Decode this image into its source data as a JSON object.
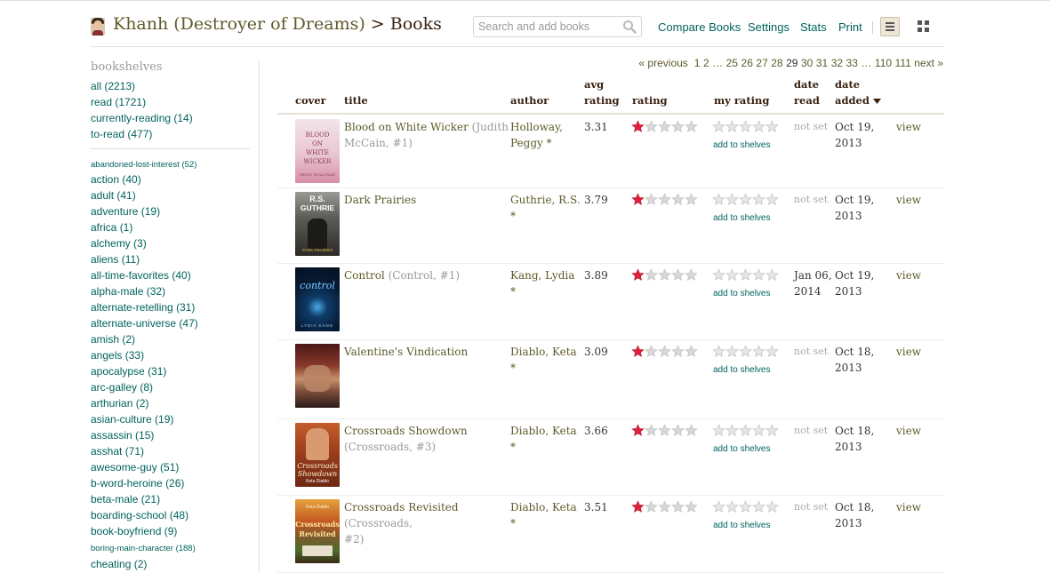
{
  "header": {
    "user_name": "Khanh (Destroyer of Dreams)",
    "breadcrumb_sep": ">",
    "section": "Books",
    "search_placeholder": "Search and add books",
    "links": [
      "Compare Books",
      "Settings",
      "Stats",
      "Print"
    ],
    "link_sep": "|"
  },
  "sidebar": {
    "heading": "bookshelves",
    "main_shelves": [
      {
        "name": "all",
        "count": "(2213)"
      },
      {
        "name": "read",
        "count": "(1721)"
      },
      {
        "name": "currently-reading",
        "count": "(14)"
      },
      {
        "name": "to-read",
        "count": "(477)"
      }
    ],
    "shelves": [
      {
        "name": "abandoned-lost-interest",
        "count": "(52)",
        "small": true
      },
      {
        "name": "action",
        "count": "(40)"
      },
      {
        "name": "adult",
        "count": "(41)"
      },
      {
        "name": "adventure",
        "count": "(19)"
      },
      {
        "name": "africa",
        "count": "(1)"
      },
      {
        "name": "alchemy",
        "count": "(3)"
      },
      {
        "name": "aliens",
        "count": "(11)"
      },
      {
        "name": "all-time-favorites",
        "count": "(40)"
      },
      {
        "name": "alpha-male",
        "count": "(32)"
      },
      {
        "name": "alternate-retelling",
        "count": "(31)"
      },
      {
        "name": "alternate-universe",
        "count": "(47)"
      },
      {
        "name": "amish",
        "count": "(2)"
      },
      {
        "name": "angels",
        "count": "(33)"
      },
      {
        "name": "apocalypse",
        "count": "(31)"
      },
      {
        "name": "arc-galley",
        "count": "(8)"
      },
      {
        "name": "arthurian",
        "count": "(2)"
      },
      {
        "name": "asian-culture",
        "count": "(19)"
      },
      {
        "name": "assassin",
        "count": "(15)"
      },
      {
        "name": "asshat",
        "count": "(71)"
      },
      {
        "name": "awesome-guy",
        "count": "(51)"
      },
      {
        "name": "b-word-heroine",
        "count": "(26)"
      },
      {
        "name": "beta-male",
        "count": "(21)"
      },
      {
        "name": "boarding-school",
        "count": "(48)"
      },
      {
        "name": "book-boyfriend",
        "count": "(9)"
      },
      {
        "name": "boring-main-character",
        "count": "(188)",
        "small": true
      },
      {
        "name": "cheating",
        "count": "(2)"
      }
    ]
  },
  "pagination": {
    "previous": "« previous",
    "pages": [
      "1",
      "2",
      "…",
      "25",
      "26",
      "27",
      "28",
      "29",
      "30",
      "31",
      "32",
      "33",
      "…",
      "110",
      "111"
    ],
    "current": "29",
    "next": "next »"
  },
  "table": {
    "headers": {
      "cover": "cover",
      "title": "title",
      "author": "author",
      "avg_rating_1": "avg",
      "avg_rating_2": "rating",
      "rating": "rating",
      "my_rating": "my rating",
      "date_read_1": "date",
      "date_read_2": "read",
      "date_added_1": "date",
      "date_added_2": "added"
    },
    "add_to_shelves": "add to shelves",
    "view_label": "view",
    "rows": [
      {
        "title": "Blood on White Wicker",
        "series_1": "(Judith",
        "series_2": "McCain, #1)",
        "author_1": "Holloway,",
        "author_2": "Peggy *",
        "avg_rating": "3.31",
        "rating": 1,
        "date_read": "not set",
        "date_added_1": "Oct 19,",
        "date_added_2": "2013",
        "cover_text_1": "BLOOD",
        "cover_text_2": "ON",
        "cover_text_3": "WHITE",
        "cover_text_4": "WICKER",
        "cover_text_5": "PEGGY HOLLOWAY"
      },
      {
        "title": "Dark Prairies",
        "series_1": "",
        "series_2": "",
        "author_1": "Guthrie, R.S. *",
        "author_2": "",
        "avg_rating": "3.79",
        "rating": 1,
        "date_read": "not set",
        "date_added_1": "Oct 19,",
        "date_added_2": "2013",
        "cover_text_1": "R.S.",
        "cover_text_2": "GUTHRIE",
        "cover_text_3": "DARK PRAIRIES"
      },
      {
        "title": "Control",
        "series_1": "(Control, #1)",
        "series_2": "",
        "author_1": "Kang, Lydia *",
        "author_2": "",
        "avg_rating": "3.89",
        "rating": 1,
        "date_read_1": "Jan 06,",
        "date_read_2": "2014",
        "date_added_1": "Oct 19,",
        "date_added_2": "2013",
        "cover_text_1": "control",
        "cover_text_2": "LYDIA KANG"
      },
      {
        "title": "Valentine's Vindication",
        "series_1": "",
        "series_2": "",
        "author_1": "Diablo, Keta *",
        "author_2": "",
        "avg_rating": "3.09",
        "rating": 1,
        "date_read": "not set",
        "date_added_1": "Oct 18,",
        "date_added_2": "2013"
      },
      {
        "title": "Crossroads Showdown",
        "series_1": "(Crossroads, #3)",
        "series_2": "",
        "author_1": "Diablo, Keta *",
        "author_2": "",
        "avg_rating": "3.66",
        "rating": 1,
        "date_read": "not set",
        "date_added_1": "Oct 18,",
        "date_added_2": "2013",
        "cover_text_1": "Crossroads",
        "cover_text_2": "Showdown",
        "cover_text_3": "Keta Diablo"
      },
      {
        "title": "Crossroads Revisited",
        "series_1": "(Crossroads,",
        "series_2": "#2)",
        "author_1": "Diablo, Keta *",
        "author_2": "",
        "avg_rating": "3.51",
        "rating": 1,
        "date_read": "not set",
        "date_added_1": "Oct 18,",
        "date_added_2": "2013",
        "cover_text_1": "Keta Diablo",
        "cover_text_2": "Crossroads",
        "cover_text_3": "Revisited"
      }
    ]
  },
  "colors": {
    "title_link": "#5f5a2a",
    "teal_link": "#00635d",
    "star_filled": "#e0203a",
    "star_empty": "#d8d8d8"
  }
}
